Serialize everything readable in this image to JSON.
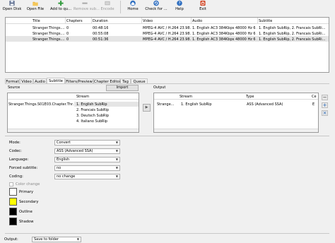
{
  "toolbar": {
    "buttons": [
      {
        "label": "Open Disk",
        "disabled": false
      },
      {
        "label": "Open File",
        "disabled": false
      },
      {
        "label": "Add to qu...",
        "disabled": false
      },
      {
        "label": "Remove sub...",
        "disabled": true
      },
      {
        "label": "Encode",
        "disabled": true
      },
      {
        "label": "Home",
        "disabled": false
      },
      {
        "label": "Check for ...",
        "disabled": false
      },
      {
        "label": "Help",
        "disabled": false
      },
      {
        "label": "Exit",
        "disabled": false
      }
    ]
  },
  "filelist": {
    "columns": [
      "Title",
      "Chapters",
      "Duration",
      "Video",
      "Audio",
      "Subtitle"
    ],
    "rows": [
      {
        "title": "Stranger.Things....",
        "chapters": "0",
        "duration": "00:48:16",
        "video": "MPEG-4 AVC / H.264 23.98...",
        "audio": "1. English AC3 384Kbps 48000 Hz 6 ...",
        "subtitle": "1. English SubRip, 2. Francais SubRi..."
      },
      {
        "title": "Stranger.Things....",
        "chapters": "0",
        "duration": "00:55:08",
        "video": "MPEG-4 AVC / H.264 23.98...",
        "audio": "1. English AC3 384Kbps 48000 Hz 6 ...",
        "subtitle": "1. English SubRip, 2. Francais SubRi..."
      },
      {
        "title": "Stranger.Things....",
        "chapters": "0",
        "duration": "00:51:36",
        "video": "MPEG-4 AVC / H.264 23.98...",
        "audio": "1. English AC3 384Kbps 48000 Hz 6 ...",
        "subtitle": "1. English SubRip, 2. Francais SubRi..."
      }
    ]
  },
  "tabs": [
    "Format",
    "Video",
    "Audio",
    "Subtitle",
    "Filters/Preview",
    "Chapter Editor",
    "Tag",
    "Queue"
  ],
  "source": {
    "label": "Source",
    "import_label": "Import",
    "column": "Stream",
    "file": "Stranger.Things.S01E03.Chapter.Thr...",
    "streams": [
      "1. English SubRip",
      "2. Francais SubRip",
      "3. Deutsch SubRip",
      "4. Italiano SubRip"
    ]
  },
  "transfer_arrow": "▶",
  "output": {
    "label": "Output",
    "columns": [
      "Stream",
      "Type",
      "Ce"
    ],
    "row": {
      "file": "Strange...",
      "stream": "1. English SubRip",
      "type": "ASS (Advanced SSA)",
      "extra": "E"
    }
  },
  "side_buttons": {
    "minus": "−",
    "plus": "+",
    "clear": "×"
  },
  "settings": {
    "mode": {
      "label": "Mode:",
      "value": "Convert"
    },
    "codec": {
      "label": "Codec:",
      "value": "ASS (Advanced SSA)"
    },
    "language": {
      "label": "Language:",
      "value": "English"
    },
    "forced": {
      "label": "Forced subtitle:",
      "value": "no"
    },
    "coding": {
      "label": "Coding:",
      "value": "no change"
    },
    "color_change": "Color change",
    "colors": [
      {
        "label": "Primary",
        "color": "#ffffff"
      },
      {
        "label": "Secondary",
        "color": "#ffff00"
      },
      {
        "label": "Outline",
        "color": "#000000"
      },
      {
        "label": "Shadow",
        "color": "#000000"
      }
    ]
  },
  "output_row": {
    "label": "Output:",
    "value": "Save to folder"
  }
}
